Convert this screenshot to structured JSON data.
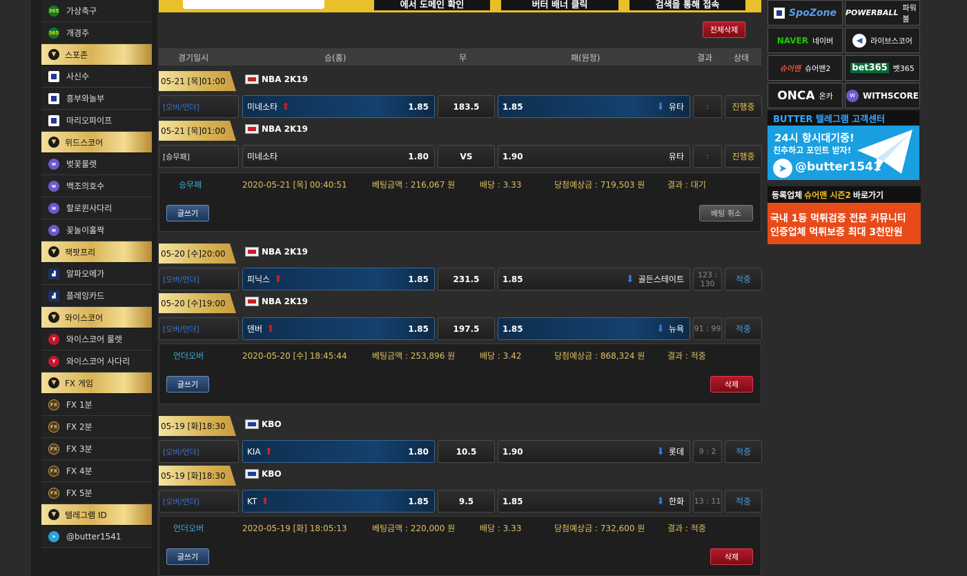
{
  "banner": {
    "panels": [
      "에서 도메인 확인",
      "버터 배너 클릭",
      "검색을 통해 접속"
    ]
  },
  "sidebar": {
    "items": [
      {
        "type": "item",
        "icon": "365-icon",
        "label": "가상축구"
      },
      {
        "type": "item",
        "icon": "365-icon",
        "label": "개경주"
      },
      {
        "type": "header",
        "label": "스포존"
      },
      {
        "type": "item",
        "icon": "spozone-icon",
        "label": "사신수"
      },
      {
        "type": "item",
        "icon": "spozone-icon",
        "label": "흥부와놀부"
      },
      {
        "type": "item",
        "icon": "spozone-icon",
        "label": "마리오파이프"
      },
      {
        "type": "header",
        "label": "위드스코어"
      },
      {
        "type": "item",
        "icon": "withscore-icon",
        "label": "벚꽃룰렛"
      },
      {
        "type": "item",
        "icon": "withscore-icon",
        "label": "백조의호수"
      },
      {
        "type": "item",
        "icon": "withscore-icon",
        "label": "할로윈사다리"
      },
      {
        "type": "item",
        "icon": "withscore-icon",
        "label": "꽃놀이홀짝"
      },
      {
        "type": "header",
        "label": "잭팟프리"
      },
      {
        "type": "item",
        "icon": "chart-icon",
        "label": "알파오메가"
      },
      {
        "type": "item",
        "icon": "chart-icon",
        "label": "플레잉카드"
      },
      {
        "type": "header",
        "label": "와이스코어"
      },
      {
        "type": "item",
        "icon": "yscore-icon",
        "label": "와이스코어 룰렛"
      },
      {
        "type": "item",
        "icon": "yscore-icon",
        "label": "와이스코어 사다리"
      },
      {
        "type": "header",
        "label": "FX 게임"
      },
      {
        "type": "item",
        "icon": "fx-icon",
        "label": "FX 1분"
      },
      {
        "type": "item",
        "icon": "fx-icon",
        "label": "FX 2분"
      },
      {
        "type": "item",
        "icon": "fx-icon",
        "label": "FX 3분"
      },
      {
        "type": "item",
        "icon": "fx-icon",
        "label": "FX 4분"
      },
      {
        "type": "item",
        "icon": "fx-icon",
        "label": "FX 5분"
      },
      {
        "type": "header",
        "label": "텔레그램 ID"
      },
      {
        "type": "item",
        "icon": "telegram-icon",
        "label": "@butter1541"
      }
    ]
  },
  "toolbar": {
    "delete_all": "전체삭제"
  },
  "columns": {
    "date": "경기일시",
    "home": "승(홈)",
    "draw": "무",
    "away": "패(원정)",
    "result": "결과",
    "status": "상태"
  },
  "groups": [
    {
      "games": [
        {
          "date": "05-21 [목]01:00",
          "league": "NBA 2K19",
          "type": "[오버/언더]",
          "home": "미네소타",
          "home_odds": "1.85",
          "mid": "183.5",
          "away_odds": "1.85",
          "away": "유타",
          "score": ":",
          "status": "진행중"
        },
        {
          "date": "05-21 [목]01:00",
          "league": "NBA 2K19",
          "type": "[승무패]",
          "home": "미네소타",
          "home_odds": "1.80",
          "mid": "VS",
          "away_odds": "1.90",
          "away": "유타",
          "score": ":",
          "status": "진행중"
        }
      ],
      "summary": {
        "bet_type": "승무패",
        "time": "2020-05-21 [목] 00:40:51",
        "amount": "베팅금액 : 216,067 원",
        "odds": "배당 : 3.33",
        "win": "당첨예상금 : 719,503 원",
        "result": "결과 : 대기",
        "write": "글쓰기",
        "action": "베팅 취소"
      }
    },
    {
      "games": [
        {
          "date": "05-20 [수]20:00",
          "league": "NBA 2K19",
          "type": "[오버/언더]",
          "home": "피닉스",
          "home_odds": "1.85",
          "mid": "231.5",
          "away_odds": "1.85",
          "away": "골든스테이트",
          "score": "123 : 130",
          "status": "적중"
        },
        {
          "date": "05-20 [수]19:00",
          "league": "NBA 2K19",
          "type": "[오버/언더]",
          "home": "덴버",
          "home_odds": "1.85",
          "mid": "197.5",
          "away_odds": "1.85",
          "away": "뉴욕",
          "score": "91 : 99",
          "status": "적중"
        }
      ],
      "summary": {
        "bet_type": "언더오버",
        "time": "2020-05-20 [수] 18:45:44",
        "amount": "베팅금액 : 253,896 원",
        "odds": "배당 : 3.42",
        "win": "당첨예상금 : 868,324 원",
        "result": "결과 : 적중",
        "write": "글쓰기",
        "action": "삭제"
      }
    },
    {
      "games": [
        {
          "date": "05-19 [화]18:30",
          "league": "KBO",
          "type": "[오버/언더]",
          "home": "KIA",
          "home_odds": "1.80",
          "mid": "10.5",
          "away_odds": "1.90",
          "away": "롯데",
          "score": "9 : 2",
          "status": "적중"
        },
        {
          "date": "05-19 [화]18:30",
          "league": "KBO",
          "type": "[오버/언더]",
          "home": "KT",
          "home_odds": "1.85",
          "mid": "9.5",
          "away_odds": "1.85",
          "away": "한화",
          "score": "13 : 11",
          "status": "적중"
        }
      ],
      "summary": {
        "bet_type": "언더오버",
        "time": "2020-05-19 [화] 18:05:13",
        "amount": "베팅금액 : 220,000 원",
        "odds": "배당 : 3.33",
        "win": "당첨예상금 : 732,600 원",
        "result": "결과 : 적중",
        "write": "글쓰기",
        "action": "삭제"
      }
    }
  ],
  "partners": [
    {
      "logo": "SpoZone",
      "label": ""
    },
    {
      "logo": "POWERBALL",
      "label": "파워볼"
    },
    {
      "logo": "NAVER",
      "label": "네이버"
    },
    {
      "logo": "",
      "label": "라이브스코어"
    },
    {
      "logo": "슈어맨",
      "label": "슈어맨2"
    },
    {
      "logo": "bet365",
      "label": "벳365"
    },
    {
      "logo": "ONCA",
      "label": "온카"
    },
    {
      "logo": "WITHSCORE",
      "label": ""
    }
  ],
  "telegram_banner": {
    "title": "BUTTER 텔레그램 고객센터",
    "line1": "24시 항시대기중!",
    "line2": "친추하고 포인트 받자!",
    "handle": "@butter1541"
  },
  "sureman_banner": {
    "pre": "등록업체",
    "brand": "슈어맨 시즌2",
    "post": "바로가기",
    "line1": "국내 1등 먹튀검증 전문 커뮤니티",
    "line2": "인증업체 먹튀보증 최대 3천만원"
  }
}
